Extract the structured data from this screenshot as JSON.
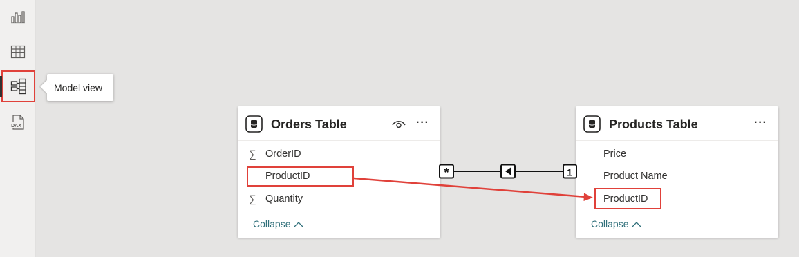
{
  "nav": {
    "items": [
      {
        "icon": "report-view-icon"
      },
      {
        "icon": "data-view-icon"
      },
      {
        "icon": "model-view-icon",
        "active": true
      },
      {
        "icon": "dax-query-view-icon",
        "label": "DAX"
      }
    ],
    "tooltip": "Model view"
  },
  "orders_table": {
    "title": "Orders Table",
    "fields": [
      {
        "label": "OrderID",
        "icon": "sigma-icon"
      },
      {
        "label": "ProductID",
        "icon": ""
      },
      {
        "label": "Quantity",
        "icon": "sigma-icon"
      }
    ],
    "collapse": "Collapse"
  },
  "products_table": {
    "title": "Products Table",
    "fields": [
      {
        "label": "Price"
      },
      {
        "label": "Product Name"
      },
      {
        "label": "ProductID"
      }
    ],
    "collapse": "Collapse"
  },
  "relationship": {
    "many_side": "*",
    "one_side": "1"
  },
  "colors": {
    "highlight": "#e0413a",
    "collapse_link": "#2f6f7a",
    "canvas": "#e5e4e3"
  }
}
